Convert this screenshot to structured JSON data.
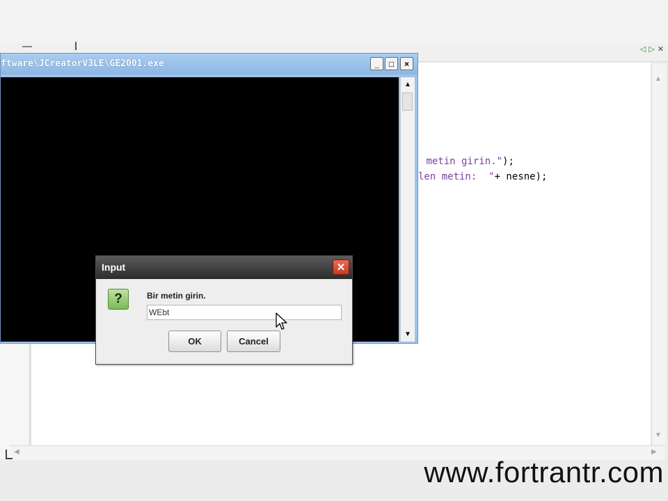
{
  "console": {
    "title": "ftware\\JCreatorV3LE\\GE2001.exe",
    "minimize_glyph": "_",
    "maximize_glyph": "□",
    "close_glyph": "×",
    "scroll_up_glyph": "▲",
    "scroll_down_glyph": "▼"
  },
  "editor": {
    "line1": {
      "prefix": " ",
      "string": "metin girin.\"",
      "suffix": ");"
    },
    "line2": {
      "string": "len metin:  \"",
      "suffix": "+ nesne);"
    }
  },
  "dialog": {
    "title": "Input",
    "close_glyph": "✕",
    "icon_glyph": "?",
    "prompt": "Bir metin girin.",
    "input_value": "WEbt",
    "ok_label": "OK",
    "cancel_label": "Cancel"
  },
  "nav": {
    "prev": "◁",
    "play": "▷",
    "close": "✕"
  },
  "watermark": "www.fortrantr.com",
  "colors": {
    "console_title": "#9ec3ea",
    "dialog_title": "#3a3a3a",
    "close_red": "#d9482f",
    "icon_green": "#8fcb6b"
  },
  "icons": [
    "question-icon",
    "close-icon",
    "minimize-icon",
    "maximize-icon",
    "cursor-icon"
  ]
}
